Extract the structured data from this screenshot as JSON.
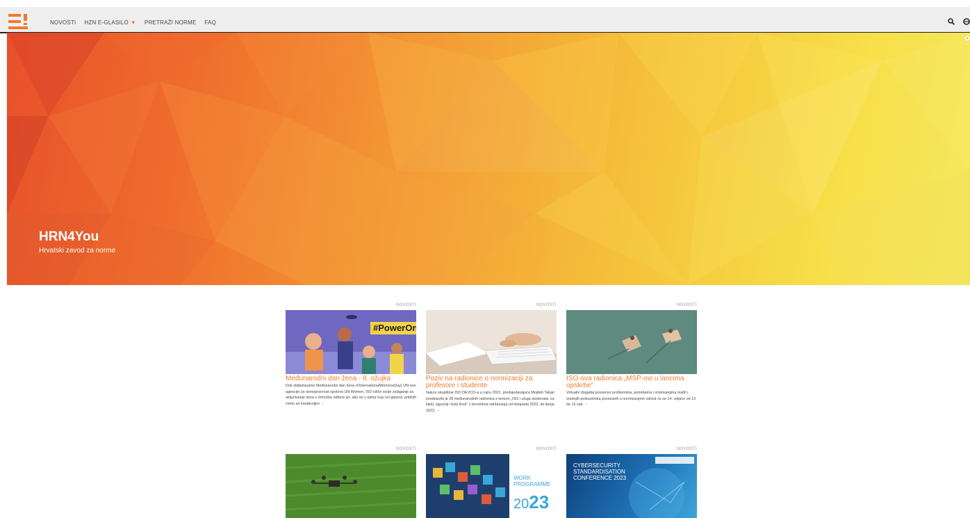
{
  "brand": {
    "logo_icon": "e-logo-icon",
    "accent_color": "#f07b2e"
  },
  "nav": {
    "items": [
      {
        "label": "NOVOSTI"
      },
      {
        "label": "HZN E-GLASILO"
      },
      {
        "label": "PRETRAŽI NORME"
      },
      {
        "label": "FAQ"
      }
    ],
    "dropdown_icon": "caret-down-icon"
  },
  "toolbar": {
    "search_icon": "search-icon",
    "language_icon": "globe-icon"
  },
  "hero": {
    "title": "HRN4You",
    "subtitle": "Hrvatski zavod za norme",
    "expand_icon": "expand-icon"
  },
  "cards": [
    {
      "tag": "NOVOSTI",
      "title": "Međunarodni dan žena - 8. ožujka",
      "text": "Dok obilježavamo Međunarodni dan žena (#InternationalWomensDay) UN-ove agencije za ravnopravnost spolova UN Women, ISO ističe svoje zalaganje za uključivanje žena u tehničke odbore jer, ako se u njima čuju svi glasovi, približit ćemo se kreativnijim",
      "image_text": "#PowerOn"
    },
    {
      "tag": "NOVOSTI",
      "title": "Poziv na radionice o normizaciji za profesore i studente",
      "text": "Nakon skupštine ISO DEVCO-a u rujnu 2021. predsjedavajuća Mojdeh Tabari predstavila je 28 međunarodnih radionica s temom „ISO i uloga studenata: za lakši, sigurniji i bolji život“ s terminima održavanja od listopada 2022. do lipnja 2023."
    },
    {
      "tag": "NOVOSTI",
      "title": "ISO-ova radionica „MSP-ovi u lancima opskrbe“",
      "text": "Virtualni događaj posvećen problemima, potrebama i očekivanjima malih i srednjih poduzetnika povezanih s normizacijom održat će se 14. veljače od 13 do 15 sati."
    },
    {
      "tag": "NOVOSTI"
    },
    {
      "tag": "NOVOSTI",
      "image_line1": "WORK",
      "image_line2": "PROGRAMME",
      "image_year_a": "20",
      "image_year_b": "23"
    },
    {
      "tag": "NOVOSTI",
      "image_line1": "CYBERSECURITY",
      "image_line2": "STANDARDISATION",
      "image_line3": "CONFERENCE 2023"
    }
  ],
  "more_glyph": "›"
}
